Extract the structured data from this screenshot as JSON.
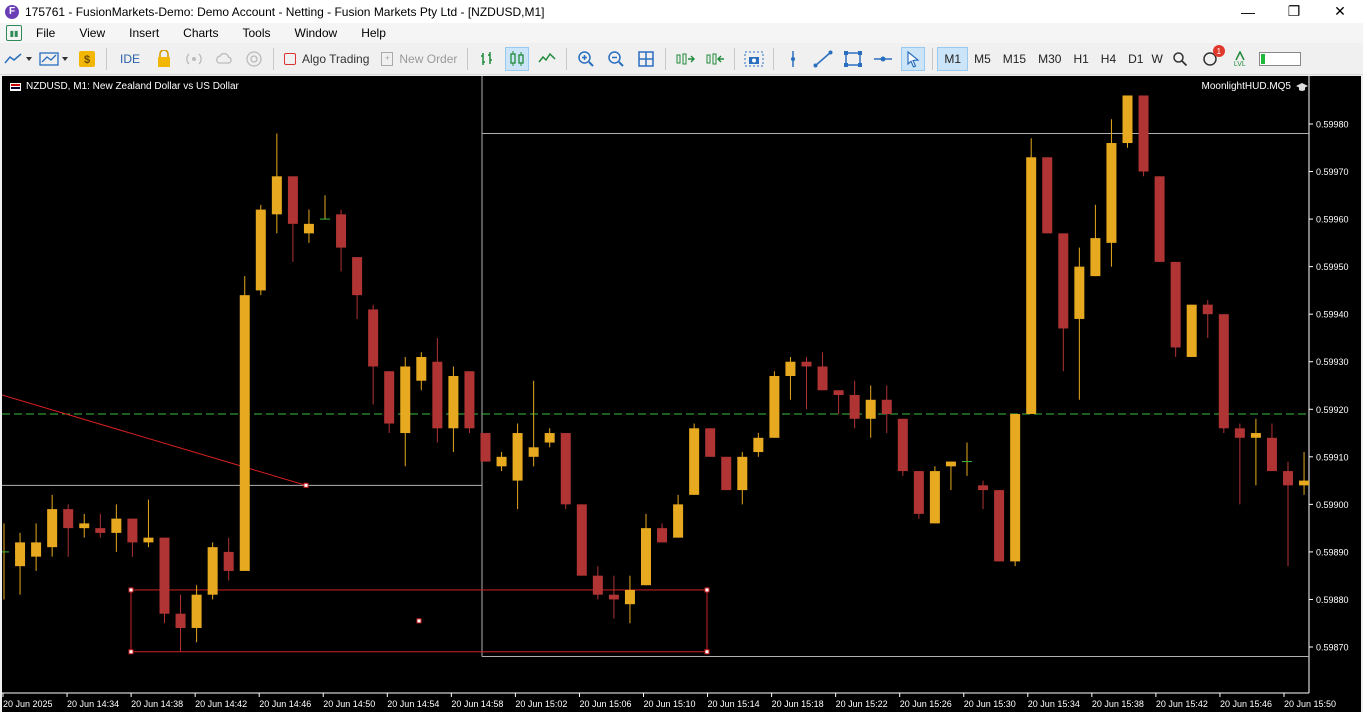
{
  "window": {
    "title": "175761 - FusionMarkets-Demo: Demo Account - Netting - Fusion Markets Pty Ltd - [NZDUSD,M1]",
    "app_icon_letter": "F",
    "minimize": "—",
    "maximize": "❐",
    "close": "✕"
  },
  "menu": [
    "File",
    "View",
    "Insert",
    "Charts",
    "Tools",
    "Window",
    "Help"
  ],
  "toolbar": {
    "ide_label": "IDE",
    "algo_trading_label": "Algo Trading",
    "new_order_label": "New Order",
    "notification_count": "1",
    "lvl_label": "LVL",
    "timeframes": [
      "M1",
      "M5",
      "M15",
      "M30",
      "H1",
      "H4",
      "D1",
      "W"
    ],
    "active_timeframe": "M1"
  },
  "chart": {
    "symbol_label": "NZDUSD, M1:  New Zealand Dollar vs US Dollar",
    "indicator_label": "MoonlightHUD.MQ5"
  },
  "colors": {
    "bull": "#e6a91f",
    "bear": "#b03434",
    "background": "#000000",
    "axis_text": "#ffffff",
    "level_line": "#3dbb3d",
    "box_line": "#cc2222",
    "grey_line": "#b0b0b0"
  },
  "chart_data": {
    "type": "candlestick",
    "symbol": "NZDUSD",
    "timeframe": "M1",
    "ylim": [
      0.59864,
      0.5999
    ],
    "y_ticks": [
      "0.59980",
      "0.59970",
      "0.59960",
      "0.59950",
      "0.59940",
      "0.59930",
      "0.59920",
      "0.59910",
      "0.59900",
      "0.59890",
      "0.59880",
      "0.59870"
    ],
    "x_tick_labels": [
      "20 Jun 2025",
      "20 Jun 14:34",
      "20 Jun 14:38",
      "20 Jun 14:42",
      "20 Jun 14:46",
      "20 Jun 14:50",
      "20 Jun 14:54",
      "20 Jun 14:58",
      "20 Jun 15:02",
      "20 Jun 15:06",
      "20 Jun 15:10",
      "20 Jun 15:14",
      "20 Jun 15:18",
      "20 Jun 15:22",
      "20 Jun 15:26",
      "20 Jun 15:30",
      "20 Jun 15:34",
      "20 Jun 15:38",
      "20 Jun 15:42",
      "20 Jun 15:46",
      "20 Jun 15:50"
    ],
    "horizontal_level": 0.59919,
    "candles": [
      {
        "o": 0.5989,
        "h": 0.59896,
        "l": 0.5988,
        "c": 0.5989
      },
      {
        "o": 0.59887,
        "h": 0.59894,
        "l": 0.59881,
        "c": 0.59892
      },
      {
        "o": 0.59889,
        "h": 0.59896,
        "l": 0.59886,
        "c": 0.59892
      },
      {
        "o": 0.59891,
        "h": 0.59902,
        "l": 0.59889,
        "c": 0.59899
      },
      {
        "o": 0.59899,
        "h": 0.599,
        "l": 0.59889,
        "c": 0.59895
      },
      {
        "o": 0.59895,
        "h": 0.59898,
        "l": 0.59893,
        "c": 0.59896
      },
      {
        "o": 0.59895,
        "h": 0.59898,
        "l": 0.59893,
        "c": 0.59894
      },
      {
        "o": 0.59894,
        "h": 0.599,
        "l": 0.5989,
        "c": 0.59897
      },
      {
        "o": 0.59897,
        "h": 0.59897,
        "l": 0.59889,
        "c": 0.59892
      },
      {
        "o": 0.59892,
        "h": 0.59901,
        "l": 0.59891,
        "c": 0.59893
      },
      {
        "o": 0.59893,
        "h": 0.59893,
        "l": 0.59875,
        "c": 0.59877
      },
      {
        "o": 0.59877,
        "h": 0.59881,
        "l": 0.59869,
        "c": 0.59874
      },
      {
        "o": 0.59874,
        "h": 0.59883,
        "l": 0.59871,
        "c": 0.59881
      },
      {
        "o": 0.59881,
        "h": 0.59892,
        "l": 0.5988,
        "c": 0.59891
      },
      {
        "o": 0.5989,
        "h": 0.59893,
        "l": 0.59884,
        "c": 0.59886
      },
      {
        "o": 0.59886,
        "h": 0.59948,
        "l": 0.59886,
        "c": 0.59944
      },
      {
        "o": 0.59945,
        "h": 0.59963,
        "l": 0.59944,
        "c": 0.59962
      },
      {
        "o": 0.59961,
        "h": 0.59978,
        "l": 0.59957,
        "c": 0.59969
      },
      {
        "o": 0.59969,
        "h": 0.59969,
        "l": 0.59951,
        "c": 0.59959
      },
      {
        "o": 0.59957,
        "h": 0.59962,
        "l": 0.59955,
        "c": 0.59959
      },
      {
        "o": 0.5996,
        "h": 0.59965,
        "l": 0.5996,
        "c": 0.5996
      },
      {
        "o": 0.59961,
        "h": 0.59962,
        "l": 0.59949,
        "c": 0.59954
      },
      {
        "o": 0.59952,
        "h": 0.59952,
        "l": 0.59939,
        "c": 0.59944
      },
      {
        "o": 0.59941,
        "h": 0.59942,
        "l": 0.59921,
        "c": 0.59929
      },
      {
        "o": 0.59928,
        "h": 0.59928,
        "l": 0.59915,
        "c": 0.59917
      },
      {
        "o": 0.59915,
        "h": 0.59931,
        "l": 0.59908,
        "c": 0.59929
      },
      {
        "o": 0.59926,
        "h": 0.59932,
        "l": 0.59924,
        "c": 0.59931
      },
      {
        "o": 0.5993,
        "h": 0.59935,
        "l": 0.59913,
        "c": 0.59916
      },
      {
        "o": 0.59916,
        "h": 0.59929,
        "l": 0.59911,
        "c": 0.59927
      },
      {
        "o": 0.59928,
        "h": 0.59928,
        "l": 0.59915,
        "c": 0.59916
      },
      {
        "o": 0.59915,
        "h": 0.59915,
        "l": 0.59909,
        "c": 0.59909
      },
      {
        "o": 0.59908,
        "h": 0.59911,
        "l": 0.59907,
        "c": 0.5991
      },
      {
        "o": 0.59905,
        "h": 0.59917,
        "l": 0.59899,
        "c": 0.59915
      },
      {
        "o": 0.5991,
        "h": 0.59926,
        "l": 0.59908,
        "c": 0.59912
      },
      {
        "o": 0.59913,
        "h": 0.59916,
        "l": 0.59912,
        "c": 0.59915
      },
      {
        "o": 0.59915,
        "h": 0.59915,
        "l": 0.59899,
        "c": 0.599
      },
      {
        "o": 0.599,
        "h": 0.599,
        "l": 0.59885,
        "c": 0.59885
      },
      {
        "o": 0.59885,
        "h": 0.59887,
        "l": 0.5988,
        "c": 0.59881
      },
      {
        "o": 0.59881,
        "h": 0.59885,
        "l": 0.59876,
        "c": 0.5988
      },
      {
        "o": 0.59879,
        "h": 0.59885,
        "l": 0.59875,
        "c": 0.59882
      },
      {
        "o": 0.59883,
        "h": 0.59898,
        "l": 0.59883,
        "c": 0.59895
      },
      {
        "o": 0.59895,
        "h": 0.59896,
        "l": 0.59892,
        "c": 0.59892
      },
      {
        "o": 0.59893,
        "h": 0.59902,
        "l": 0.59893,
        "c": 0.599
      },
      {
        "o": 0.59902,
        "h": 0.59917,
        "l": 0.59902,
        "c": 0.59916
      },
      {
        "o": 0.59916,
        "h": 0.59916,
        "l": 0.5991,
        "c": 0.5991
      },
      {
        "o": 0.5991,
        "h": 0.5991,
        "l": 0.59903,
        "c": 0.59903
      },
      {
        "o": 0.59903,
        "h": 0.59911,
        "l": 0.599,
        "c": 0.5991
      },
      {
        "o": 0.59911,
        "h": 0.59915,
        "l": 0.5991,
        "c": 0.59914
      },
      {
        "o": 0.59914,
        "h": 0.59928,
        "l": 0.59914,
        "c": 0.59927
      },
      {
        "o": 0.59927,
        "h": 0.59931,
        "l": 0.59922,
        "c": 0.5993
      },
      {
        "o": 0.5993,
        "h": 0.59931,
        "l": 0.5992,
        "c": 0.59929
      },
      {
        "o": 0.59929,
        "h": 0.59932,
        "l": 0.59925,
        "c": 0.59924
      },
      {
        "o": 0.59924,
        "h": 0.59924,
        "l": 0.59919,
        "c": 0.59923
      },
      {
        "o": 0.59923,
        "h": 0.59926,
        "l": 0.59916,
        "c": 0.59918
      },
      {
        "o": 0.59918,
        "h": 0.59925,
        "l": 0.59914,
        "c": 0.59922
      },
      {
        "o": 0.59922,
        "h": 0.59925,
        "l": 0.59915,
        "c": 0.59919
      },
      {
        "o": 0.59918,
        "h": 0.59918,
        "l": 0.59906,
        "c": 0.59907
      },
      {
        "o": 0.59907,
        "h": 0.59907,
        "l": 0.59897,
        "c": 0.59898
      },
      {
        "o": 0.59896,
        "h": 0.59908,
        "l": 0.59896,
        "c": 0.59907
      },
      {
        "o": 0.59908,
        "h": 0.59909,
        "l": 0.59903,
        "c": 0.59909
      },
      {
        "o": 0.59909,
        "h": 0.59913,
        "l": 0.59906,
        "c": 0.59909
      },
      {
        "o": 0.59904,
        "h": 0.59905,
        "l": 0.59899,
        "c": 0.59903
      },
      {
        "o": 0.59903,
        "h": 0.59903,
        "l": 0.59888,
        "c": 0.59888
      },
      {
        "o": 0.59888,
        "h": 0.59919,
        "l": 0.59887,
        "c": 0.59919
      },
      {
        "o": 0.59919,
        "h": 0.59977,
        "l": 0.59919,
        "c": 0.59973
      },
      {
        "o": 0.59973,
        "h": 0.59973,
        "l": 0.59957,
        "c": 0.59957
      },
      {
        "o": 0.59957,
        "h": 0.59957,
        "l": 0.59928,
        "c": 0.59937
      },
      {
        "o": 0.59939,
        "h": 0.59954,
        "l": 0.59922,
        "c": 0.5995
      },
      {
        "o": 0.59948,
        "h": 0.59963,
        "l": 0.59948,
        "c": 0.59956
      },
      {
        "o": 0.59955,
        "h": 0.59981,
        "l": 0.5995,
        "c": 0.59976
      },
      {
        "o": 0.59976,
        "h": 0.59986,
        "l": 0.59975,
        "c": 0.59986
      },
      {
        "o": 0.59986,
        "h": 0.59986,
        "l": 0.59969,
        "c": 0.5997
      },
      {
        "o": 0.59969,
        "h": 0.59969,
        "l": 0.59951,
        "c": 0.59951
      },
      {
        "o": 0.59951,
        "h": 0.59951,
        "l": 0.59931,
        "c": 0.59933
      },
      {
        "o": 0.59931,
        "h": 0.59942,
        "l": 0.59931,
        "c": 0.59942
      },
      {
        "o": 0.59942,
        "h": 0.59943,
        "l": 0.59935,
        "c": 0.5994
      },
      {
        "o": 0.5994,
        "h": 0.5994,
        "l": 0.59915,
        "c": 0.59916
      },
      {
        "o": 0.59916,
        "h": 0.59917,
        "l": 0.599,
        "c": 0.59914
      },
      {
        "o": 0.59914,
        "h": 0.59918,
        "l": 0.59904,
        "c": 0.59915
      },
      {
        "o": 0.59914,
        "h": 0.59917,
        "l": 0.5991,
        "c": 0.59907
      },
      {
        "o": 0.59907,
        "h": 0.59909,
        "l": 0.59887,
        "c": 0.59904
      },
      {
        "o": 0.59904,
        "h": 0.59911,
        "l": 0.59902,
        "c": 0.59905
      }
    ],
    "objects": {
      "grey_line_left_price": 0.59904,
      "grey_line_top_price": 0.59978,
      "grey_line_bottom_price": 0.59868,
      "red_box_top_price": 0.59882,
      "red_box_bottom_price": 0.59869,
      "red_trend_start_price": 0.59923,
      "red_trend_end_price": 0.59904
    }
  }
}
